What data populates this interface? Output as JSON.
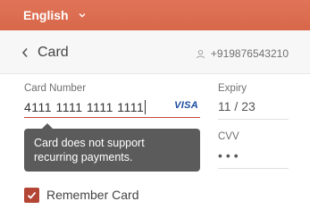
{
  "top_bar": {
    "language": "English",
    "chevron_icon": "chevron-down-icon",
    "color": "#dc6e51"
  },
  "header": {
    "back_icon": "chevron-left-icon",
    "title": "Card",
    "contact_icon": "user-icon",
    "contact": "+919876543210"
  },
  "form": {
    "card_number_label": "Card Number",
    "card_number_value": "4111 1111 1111 1111",
    "card_brand": "VISA",
    "expiry_label": "Expiry",
    "expiry_value": "11 / 23",
    "cvv_label": "CVV",
    "cvv_value": "•••",
    "error_color": "#c9423c"
  },
  "tooltip": {
    "message_line1": "Card does not support",
    "message_line2": "recurring payments."
  },
  "remember": {
    "label": "Remember Card",
    "checked": true,
    "checkbox_color": "#b34535"
  }
}
